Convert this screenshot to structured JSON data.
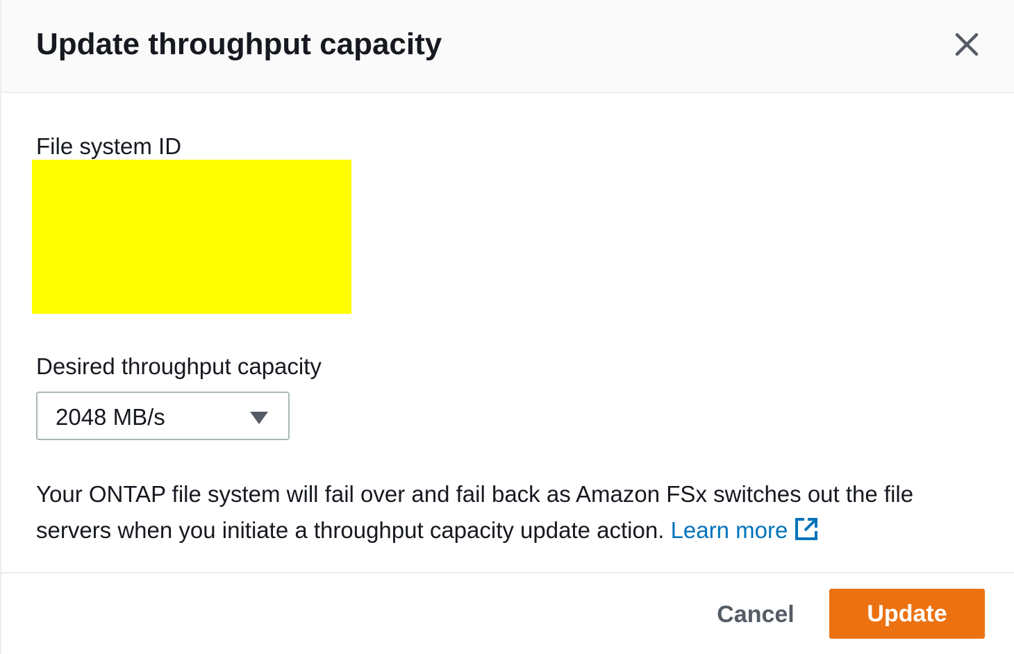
{
  "modal": {
    "title": "Update throughput capacity",
    "close_icon": "close-icon"
  },
  "file_system": {
    "label": "File system ID",
    "redaction_color": "#ffff00"
  },
  "throughput": {
    "label": "Desired throughput capacity",
    "selected_value": "2048 MB/s",
    "caret_icon": "caret-down-icon"
  },
  "notice": {
    "text": "Your ONTAP file system will fail over and fail back as Amazon FSx switches out the file servers when you initiate a throughput capacity update action. ",
    "link_label": "Learn more",
    "link_icon": "external-link-icon"
  },
  "footer": {
    "cancel_label": "Cancel",
    "update_label": "Update"
  },
  "colors": {
    "primary_button": "#ec7211",
    "link": "#0073bb",
    "header_background": "#fafafa",
    "text": "#16191f",
    "secondary_text": "#545b64"
  }
}
